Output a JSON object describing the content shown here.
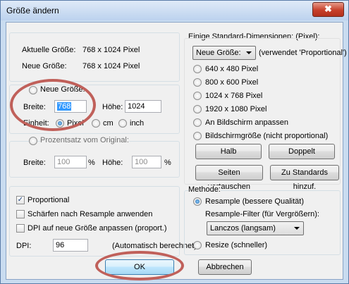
{
  "window": {
    "title": "Größe ändern",
    "close_glyph": "✖"
  },
  "current": {
    "width_label": "Aktuelle Größe:",
    "width_value": "768 x 1024  Pixel",
    "new_label": "Neue Größe:",
    "new_value": "768 x 1024  Pixel"
  },
  "new_size": {
    "radio_label": "Neue Größe:",
    "width_label": "Breite:",
    "width_value": "768",
    "height_label": "Höhe:",
    "height_value": "1024",
    "unit_label": "Einheit:",
    "unit_pixel": "Pixel",
    "unit_cm": "cm",
    "unit_inch": "inch"
  },
  "percent": {
    "radio_label": "Prozentsatz vom Original:",
    "width_label": "Breite:",
    "width_value": "100",
    "width_unit": "%",
    "height_label": "Höhe:",
    "height_value": "100",
    "height_unit": "%"
  },
  "options": {
    "proportional": "Proportional",
    "sharpen": "Schärfen nach Resample anwenden",
    "dpi_adjust": "DPI auf neue Größe anpassen (proport.)",
    "dpi_label": "DPI:",
    "dpi_value": "96",
    "dpi_note": "(Automatisch berechnet)"
  },
  "standard": {
    "title": "Einige Standard-Dimensionen: (Pixel):",
    "select_value": "Neue Größe:",
    "select_note": "(verwendet 'Proportional')",
    "r640": "640 x 480 Pixel",
    "r800": "800 x 600 Pixel",
    "r1024": "1024 x 768 Pixel",
    "r1920": "1920 x 1080 Pixel",
    "fit": "An Bildschirm anpassen",
    "screen": "Bildschirmgröße (nicht proportional)",
    "half": "Halb",
    "double": "Doppelt",
    "swap": "Seiten vertauschen",
    "add_std": "Zu Standards hinzuf."
  },
  "method": {
    "title": "Methode:",
    "resample": "Resample (bessere Qualität)",
    "filter_label": "Resample-Filter (für Vergrößern):",
    "filter_value": "Lanczos (langsam)",
    "resize": "Resize (schneller)"
  },
  "buttons": {
    "ok": "OK",
    "cancel": "Abbrechen"
  },
  "colors": {
    "highlight_ring": "#c0605a",
    "accent": "#3399ff"
  }
}
